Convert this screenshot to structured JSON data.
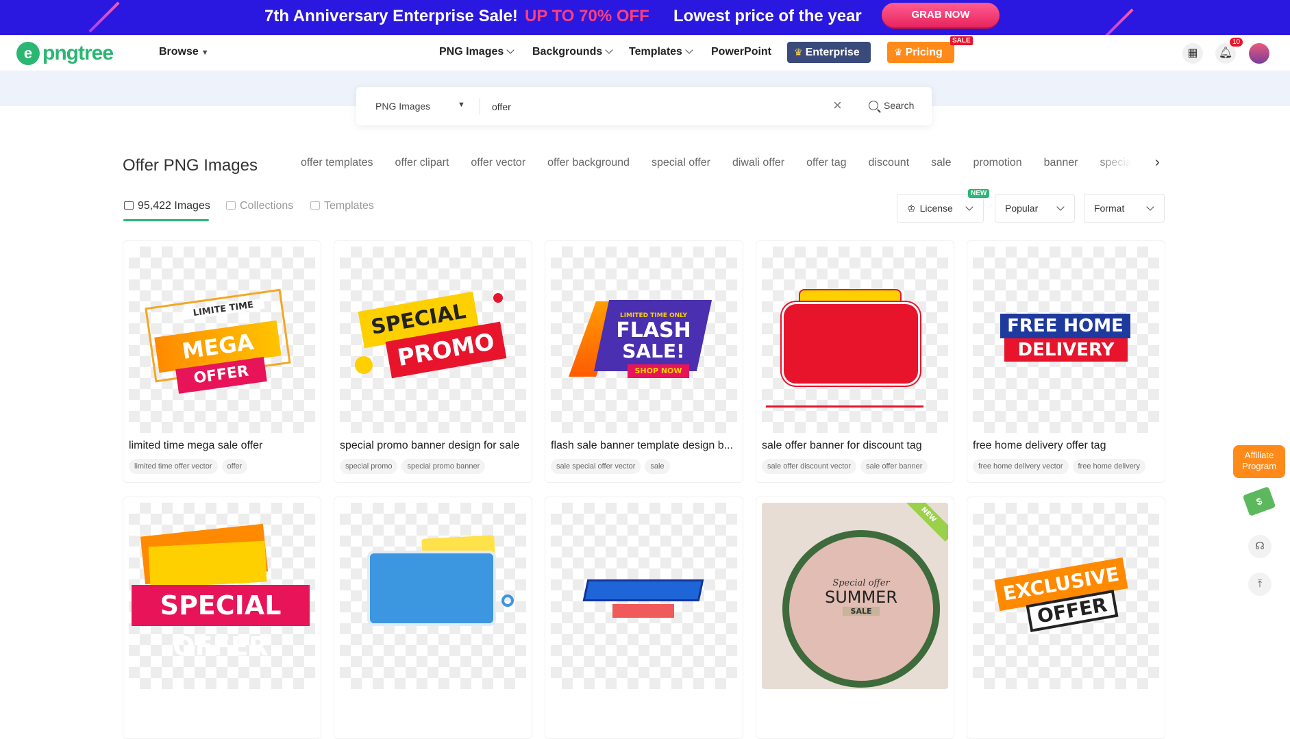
{
  "promo": {
    "text1": "7th Anniversary Enterprise Sale!",
    "text2": "UP TO 70% OFF",
    "text3": "Lowest price of the year",
    "button": "GRAB NOW"
  },
  "header": {
    "logo": "pngtree",
    "browse": "Browse",
    "nav": [
      "PNG Images",
      "Backgrounds",
      "Templates",
      "PowerPoint"
    ],
    "enterprise": "Enterprise",
    "pricing": "Pricing",
    "sale_badge": "SALE",
    "notification_count": "10"
  },
  "search": {
    "type": "PNG Images",
    "query": "offer",
    "button": "Search"
  },
  "page": {
    "title": "Offer PNG Images",
    "related_tags": [
      "offer templates",
      "offer clipart",
      "offer vector",
      "offer background",
      "special offer",
      "diwali offer",
      "offer tag",
      "discount",
      "sale",
      "promotion",
      "banner",
      "special"
    ]
  },
  "tabs": {
    "images": "95,422 Images",
    "collections": "Collections",
    "templates": "Templates"
  },
  "filters": {
    "license": "License",
    "license_badge": "NEW",
    "sort": "Popular",
    "format": "Format"
  },
  "cards": [
    {
      "title": "limited time mega sale offer",
      "tags": [
        "limited time offer vector",
        "offer"
      ],
      "art": [
        "LIMITE TIME",
        "MEGA",
        "OFFER"
      ]
    },
    {
      "title": "special promo banner design for sale",
      "tags": [
        "special promo",
        "special promo banner"
      ],
      "art": [
        "SPECIAL",
        "PROMO"
      ]
    },
    {
      "title": "flash sale banner template design b...",
      "tags": [
        "sale special offer vector",
        "sale"
      ],
      "art": [
        "LIMITED TIME ONLY",
        "FLASH",
        "SALE!",
        "SHOP NOW"
      ]
    },
    {
      "title": "sale offer banner for discount tag",
      "tags": [
        "sale offer discount vector",
        "sale offer banner"
      ],
      "art": []
    },
    {
      "title": "free home delivery offer tag",
      "tags": [
        "free home delivery vector",
        "free home delivery"
      ],
      "art": [
        "FREE HOME",
        "DELIVERY"
      ]
    },
    {
      "art": [
        "SPECIAL OFFER"
      ]
    },
    {
      "art": []
    },
    {
      "art": []
    },
    {
      "art": [
        "Special offer",
        "SUMMER",
        "SALE"
      ],
      "badge": "NEW"
    },
    {
      "art": [
        "EXCLUSIVE",
        "OFFER"
      ]
    }
  ],
  "side": {
    "affiliate": "Affiliate Program"
  }
}
